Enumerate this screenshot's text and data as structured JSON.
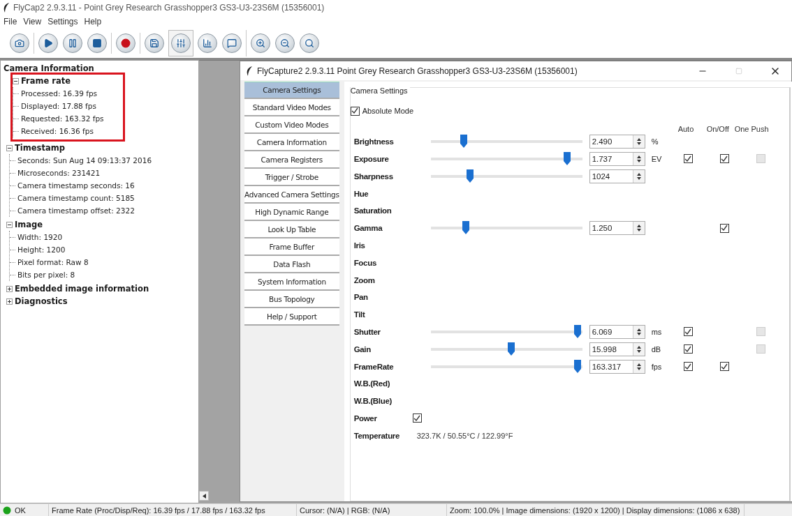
{
  "window": {
    "title": "FlyCap2 2.9.3.11 - Point Grey Research Grasshopper3 GS3-U3-23S6M (15356001)"
  },
  "menu": [
    "File",
    "View",
    "Settings",
    "Help"
  ],
  "toolbar": {
    "groups": [
      [
        {
          "pressed": false
        }
      ],
      [
        {
          "pressed": false
        },
        {
          "pressed": false
        },
        {
          "pressed": false
        }
      ],
      [
        {
          "pressed": false
        }
      ],
      [
        {
          "pressed": false
        },
        {
          "pressed": true
        },
        {
          "pressed": false
        },
        {
          "pressed": false
        }
      ],
      [
        {
          "pressed": false
        },
        {
          "pressed": false
        },
        {
          "pressed": false
        }
      ]
    ]
  },
  "info_panel": {
    "title": "Camera Information",
    "tree": [
      {
        "label": "Frame rate",
        "expanded": true,
        "highlighted": true,
        "children": [
          {
            "label": "Processed: 16.39 fps"
          },
          {
            "label": "Displayed: 17.88 fps"
          },
          {
            "label": "Requested: 163.32 fps"
          },
          {
            "label": "Received: 16.36 fps"
          }
        ]
      },
      {
        "label": "Timestamp",
        "expanded": true,
        "highlighted": false,
        "children": [
          {
            "label": "Seconds: Sun Aug 14 09:13:37 2016"
          },
          {
            "label": "Microseconds: 231421"
          },
          {
            "label": "Camera timestamp seconds: 16"
          },
          {
            "label": "Camera timestamp count:  5185"
          },
          {
            "label": "Camera timestamp offset: 2322"
          }
        ]
      },
      {
        "label": "Image",
        "expanded": true,
        "highlighted": false,
        "children": [
          {
            "label": "Width: 1920"
          },
          {
            "label": "Height: 1200"
          },
          {
            "label": "Pixel format: Raw 8"
          },
          {
            "label": "Bits per pixel:  8"
          }
        ]
      },
      {
        "label": "Embedded image information",
        "expanded": false,
        "highlighted": false
      },
      {
        "label": "Diagnostics",
        "expanded": false,
        "highlighted": false
      }
    ]
  },
  "dialog": {
    "title": "FlyCapture2 2.9.3.11  Point Grey Research Grasshopper3 GS3-U3-23S6M (15356001)",
    "maximize_disabled": true,
    "nav": [
      {
        "label": "Camera Settings",
        "selected": true
      },
      {
        "label": "Standard Video Modes",
        "selected": false
      },
      {
        "label": "Custom Video Modes",
        "selected": false
      },
      {
        "label": "Camera Information",
        "selected": false
      },
      {
        "label": "Camera Registers",
        "selected": false
      },
      {
        "label": "Trigger / Strobe",
        "selected": false
      },
      {
        "label": "Advanced Camera Settings",
        "selected": false
      },
      {
        "label": "High Dynamic Range",
        "selected": false
      },
      {
        "label": "Look Up Table",
        "selected": false
      },
      {
        "label": "Frame Buffer",
        "selected": false
      },
      {
        "label": "Data Flash",
        "selected": false
      },
      {
        "label": "System Information",
        "selected": false
      },
      {
        "label": "Bus Topology",
        "selected": false
      },
      {
        "label": "Help / Support",
        "selected": false
      }
    ],
    "group_title": "Camera Settings",
    "absolute_mode": {
      "label": "Absolute Mode",
      "checked": true
    },
    "headers": [
      "Auto",
      "On/Off",
      "One Push"
    ],
    "properties": [
      {
        "kind": "slider",
        "name": "Brightness",
        "level": 0.22,
        "value": "2.490",
        "unit": "%"
      },
      {
        "kind": "slider",
        "name": "Exposure",
        "level": 0.9,
        "value": "1.737",
        "unit": "EV",
        "auto": {
          "checked": true,
          "disabled": false
        },
        "on_off": {
          "checked": true,
          "disabled": false
        },
        "one_push": {
          "checked": false,
          "disabled": true
        }
      },
      {
        "kind": "slider",
        "name": "Sharpness",
        "level": 0.26,
        "value": "1024"
      },
      {
        "kind": "plain",
        "name": "Hue"
      },
      {
        "kind": "plain",
        "name": "Saturation"
      },
      {
        "kind": "slider",
        "name": "Gamma",
        "level": 0.23,
        "value": "1.250",
        "on_off": {
          "checked": true,
          "disabled": false
        }
      },
      {
        "kind": "plain",
        "name": "Iris"
      },
      {
        "kind": "plain",
        "name": "Focus"
      },
      {
        "kind": "plain",
        "name": "Zoom"
      },
      {
        "kind": "plain",
        "name": "Pan"
      },
      {
        "kind": "plain",
        "name": "Tilt"
      },
      {
        "kind": "slider",
        "name": "Shutter",
        "level": 0.97,
        "value": "6.069",
        "unit": "ms",
        "auto": {
          "checked": true,
          "disabled": false
        },
        "one_push": {
          "checked": false,
          "disabled": true
        }
      },
      {
        "kind": "slider",
        "name": "Gain",
        "level": 0.53,
        "value": "15.998",
        "unit": "dB",
        "auto": {
          "checked": true,
          "disabled": false
        },
        "one_push": {
          "checked": false,
          "disabled": true
        }
      },
      {
        "kind": "slider",
        "name": "FrameRate",
        "level": 0.97,
        "value": "163.317",
        "unit": "fps",
        "auto": {
          "checked": true,
          "disabled": false
        },
        "on_off": {
          "checked": true,
          "disabled": false
        }
      },
      {
        "kind": "plain",
        "name": "W.B.(Red)"
      },
      {
        "kind": "plain",
        "name": "W.B.(Blue)"
      },
      {
        "kind": "checkbox",
        "name": "Power",
        "checked": true
      },
      {
        "kind": "reading",
        "name": "Temperature",
        "value": "323.7K / 50.55°C / 122.99°F"
      }
    ]
  },
  "status_bar": {
    "status": "OK",
    "fields": [
      "Frame Rate (Proc/Disp/Req): 16.39 fps / 17.88 fps / 163.32 fps",
      "Cursor: (N/A) | RGB: (N/A)",
      "Zoom: 100.0% | Image dimensions: (1920 x 1200) | Display dimensions: (1086 x 638)"
    ]
  }
}
